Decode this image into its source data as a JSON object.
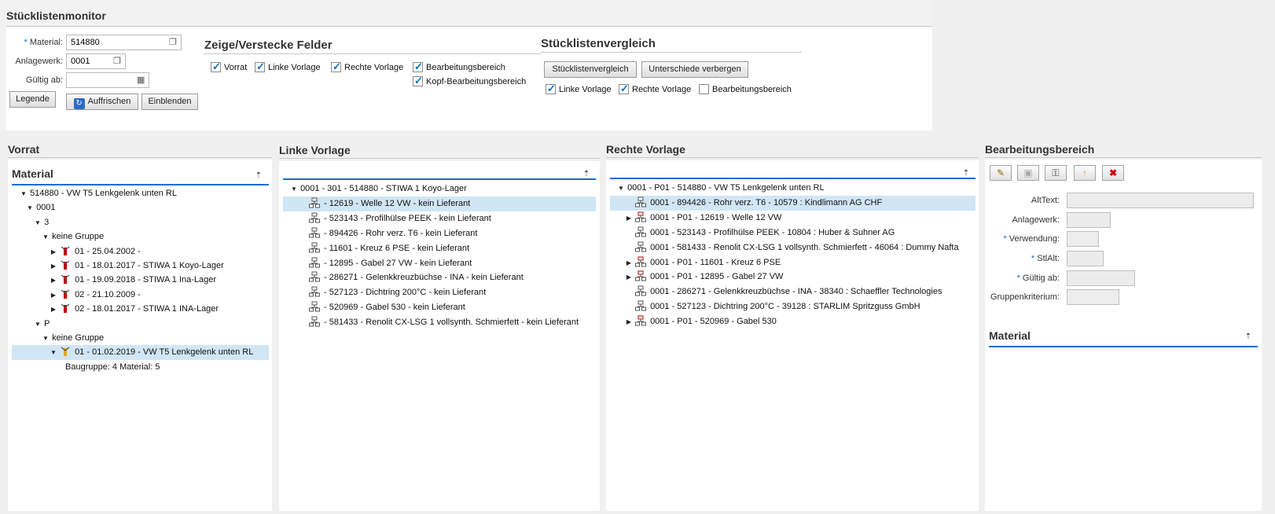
{
  "app_title": "Stücklistenmonitor",
  "form": {
    "material_label": "Material:",
    "material_value": "514880",
    "anlagewerk_label": "Anlagewerk:",
    "anlagewerk_value": "0001",
    "gueltig_label": "Gültig ab:",
    "gueltig_value": "",
    "required_mark": "*"
  },
  "buttons": {
    "legende": "Legende",
    "auffrischen": "Auffrischen",
    "einblenden": "Einblenden",
    "stuecklistenvergleich": "Stücklistenvergleich",
    "unterschiede": "Unterschiede verbergen"
  },
  "felder": {
    "title": "Zeige/Verstecke Felder",
    "checkboxes": [
      {
        "label": "Vorrat",
        "checked": true
      },
      {
        "label": "Linke Vorlage",
        "checked": true
      },
      {
        "label": "Rechte Vorlage",
        "checked": true
      },
      {
        "label": "Bearbeitungsbereich",
        "checked": true
      },
      {
        "label": "Kopf-Bearbeitungsbereich",
        "checked": true
      }
    ]
  },
  "vergleich": {
    "title": "Stücklistenvergleich",
    "checkboxes": [
      {
        "label": "Linke Vorlage",
        "checked": true
      },
      {
        "label": "Rechte Vorlage",
        "checked": true
      },
      {
        "label": "Bearbeitungsbereich",
        "checked": false
      }
    ]
  },
  "vorrat": {
    "title": "Vorrat",
    "subtitle": "Material",
    "rows": [
      {
        "text": "514880 - VW T5 Lenkgelenk unten RL",
        "arrow": "down",
        "icon": "none",
        "selected": false
      },
      {
        "text": "0001",
        "arrow": "down",
        "icon": "none",
        "selected": false
      },
      {
        "text": "3",
        "arrow": "down",
        "icon": "none",
        "selected": false
      },
      {
        "text": "keine Gruppe",
        "arrow": "down",
        "icon": "none",
        "selected": false
      },
      {
        "text": "01 - 25.04.2002 -",
        "arrow": "right",
        "icon": "red",
        "selected": false
      },
      {
        "text": "01 - 18.01.2017 - STIWA 1 Koyo-Lager",
        "arrow": "right",
        "icon": "red",
        "selected": false
      },
      {
        "text": "01 - 19.09.2018 - STIWA 1 Ina-Lager",
        "arrow": "right",
        "icon": "red",
        "selected": false
      },
      {
        "text": "02 - 21.10.2009 -",
        "arrow": "right",
        "icon": "red",
        "selected": false
      },
      {
        "text": "02 - 18.01.2017 - STIWA 1 INA-Lager",
        "arrow": "right",
        "icon": "red",
        "selected": false
      },
      {
        "text": "P",
        "arrow": "down",
        "icon": "none",
        "selected": false
      },
      {
        "text": "keine Gruppe",
        "arrow": "down",
        "icon": "none",
        "selected": false
      },
      {
        "text": "01 - 01.02.2019 - VW T5 Lenkgelenk unten RL",
        "arrow": "down",
        "icon": "yellow",
        "selected": true
      },
      {
        "text": "Baugruppe: 4 Material: 5",
        "arrow": "none",
        "icon": "none",
        "selected": false
      }
    ]
  },
  "linke": {
    "title": "Linke Vorlage",
    "rows": [
      {
        "text": "0001 - 301 - 514880 - STIWA 1 Koyo-Lager",
        "arrow": "down",
        "icon": "none",
        "selected": false
      },
      {
        "text": "- 12619 - Welle 12 VW - kein Lieferant",
        "arrow": "none",
        "icon": "tree",
        "selected": true
      },
      {
        "text": "- 523143 - Profilhülse PEEK - kein Lieferant",
        "arrow": "none",
        "icon": "tree",
        "selected": false
      },
      {
        "text": "- 894426 - Rohr verz. T6 - kein Lieferant",
        "arrow": "none",
        "icon": "tree",
        "selected": false
      },
      {
        "text": "- 11601 - Kreuz 6 PSE - kein Lieferant",
        "arrow": "none",
        "icon": "tree",
        "selected": false
      },
      {
        "text": "- 12895 - Gabel 27 VW - kein Lieferant",
        "arrow": "none",
        "icon": "tree",
        "selected": false
      },
      {
        "text": "- 286271 - Gelenkkreuzbüchse - INA - kein Lieferant",
        "arrow": "none",
        "icon": "tree",
        "selected": false
      },
      {
        "text": "- 527123 - Dichtring 200°C - kein Lieferant",
        "arrow": "none",
        "icon": "tree",
        "selected": false
      },
      {
        "text": "- 520969 - Gabel 530 - kein Lieferant",
        "arrow": "none",
        "icon": "tree",
        "selected": false
      },
      {
        "text": "- 581433 - Renolit CX-LSG 1 vollsynth. Schmierfett - kein Lieferant",
        "arrow": "none",
        "icon": "tree",
        "selected": false
      }
    ]
  },
  "rechte": {
    "title": "Rechte Vorlage",
    "rows": [
      {
        "text": "0001 - P01 - 514880 - VW T5 Lenkgelenk unten RL",
        "arrow": "down",
        "icon": "none",
        "selected": false
      },
      {
        "text": "0001 - 894426 - Rohr verz. T6 - 10579 : Kindlimann AG CHF",
        "arrow": "none",
        "icon": "tree",
        "selected": true
      },
      {
        "text": "0001 - P01 - 12619 - Welle 12 VW",
        "arrow": "right",
        "icon": "treered",
        "selected": false
      },
      {
        "text": "0001 - 523143 - Profilhülse PEEK - 10804 : Huber & Suhner AG",
        "arrow": "none",
        "icon": "tree",
        "selected": false
      },
      {
        "text": "0001 - 581433 - Renolit CX-LSG 1 vollsynth. Schmierfett - 46064 : Dummy Nafta",
        "arrow": "none",
        "icon": "tree",
        "selected": false
      },
      {
        "text": "0001 - P01 - 11601 - Kreuz 6 PSE",
        "arrow": "right",
        "icon": "treered",
        "selected": false
      },
      {
        "text": "0001 - P01 - 12895 - Gabel 27 VW",
        "arrow": "right",
        "icon": "treered",
        "selected": false
      },
      {
        "text": "0001 - 286271 - Gelenkkreuzbüchse - INA - 38340 : Schaeffler Technologies",
        "arrow": "none",
        "icon": "tree",
        "selected": false
      },
      {
        "text": "0001 - 527123 - Dichtring 200°C - 39128 : STARLIM Spritzguss GmbH",
        "arrow": "none",
        "icon": "tree",
        "selected": false
      },
      {
        "text": "0001 - P01 - 520969 - Gabel 530",
        "arrow": "right",
        "icon": "treered",
        "selected": false
      }
    ]
  },
  "bearbeitung": {
    "title": "Bearbeitungsbereich",
    "fields": [
      {
        "label": "AltText:",
        "required": false
      },
      {
        "label": "Anlagewerk:",
        "required": false
      },
      {
        "label": "Verwendung:",
        "required": true
      },
      {
        "label": "StlAlt:",
        "required": true
      },
      {
        "label": "Gültig ab:",
        "required": true
      },
      {
        "label": "Gruppenkriterium:",
        "required": false
      }
    ],
    "material_subtitle": "Material"
  }
}
